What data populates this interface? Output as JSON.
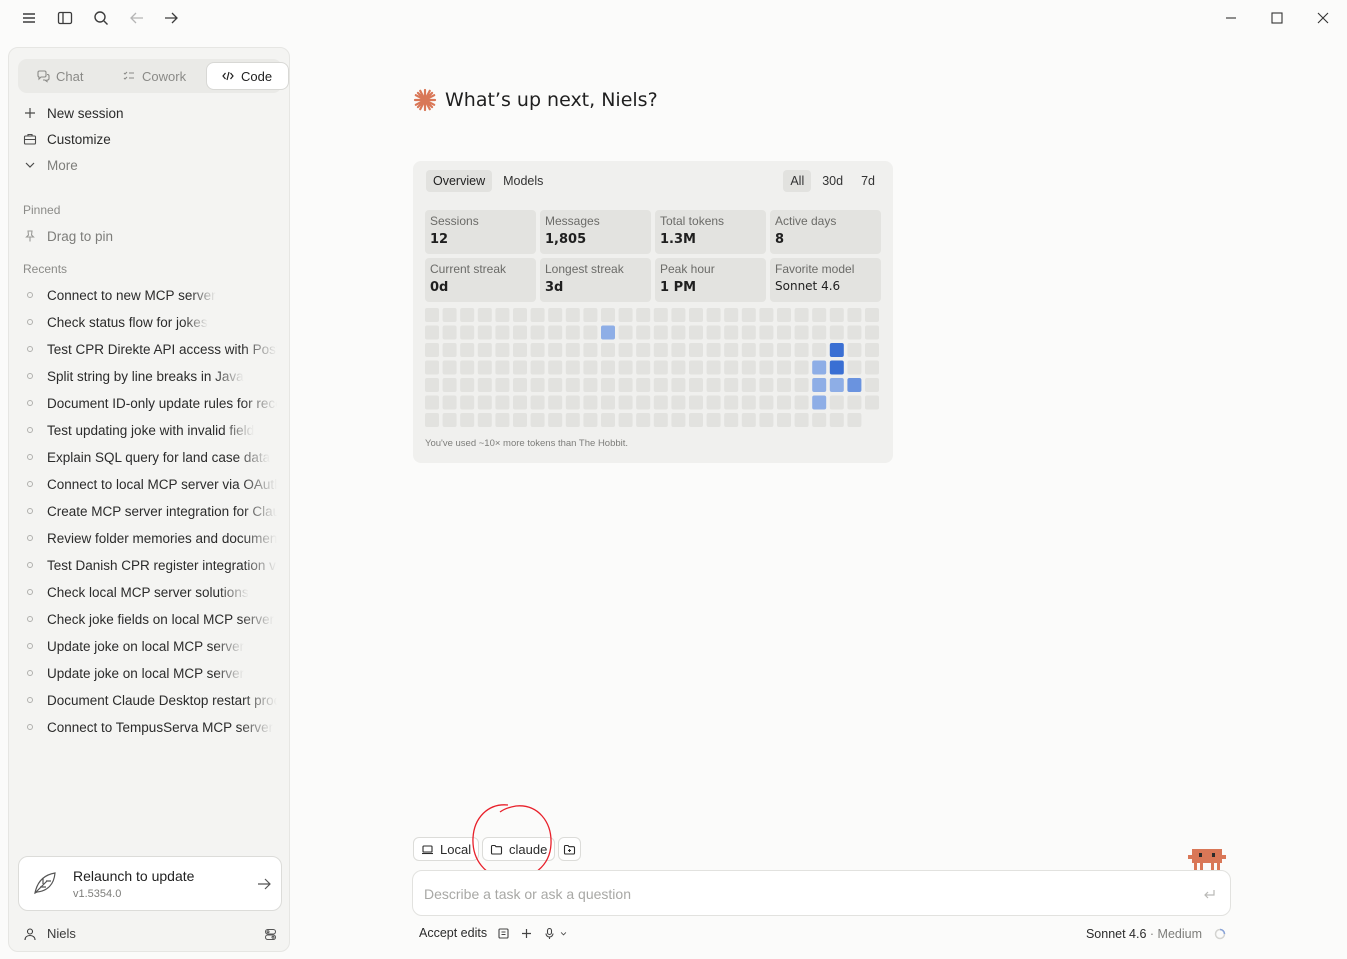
{
  "titlebar": {
    "icons": [
      "menu-icon",
      "sidebar-toggle-icon",
      "search-icon",
      "back-arrow-icon",
      "forward-arrow-icon"
    ],
    "window_controls": [
      "minimize-icon",
      "maximize-icon",
      "close-icon"
    ]
  },
  "sidebar": {
    "modes": [
      {
        "label": "Chat",
        "icon": "chat-icon",
        "active": false
      },
      {
        "label": "Cowork",
        "icon": "cowork-icon",
        "active": false
      },
      {
        "label": "Code",
        "icon": "code-icon",
        "active": true
      }
    ],
    "nav": [
      {
        "label": "New session",
        "icon": "plus-icon"
      },
      {
        "label": "Customize",
        "icon": "briefcase-icon"
      },
      {
        "label": "More",
        "icon": "chevron-down-icon"
      }
    ],
    "pinned_label": "Pinned",
    "drag_to_pin": "Drag to pin",
    "recents_label": "Recents",
    "recents": [
      "Connect to new MCP server",
      "Check status flow for jokes",
      "Test CPR Direkte API access with Postman",
      "Split string by line breaks in Java",
      "Document ID-only update rules for records",
      "Test updating joke with invalid field",
      "Explain SQL query for land case data",
      "Connect to local MCP server via OAuth",
      "Create MCP server integration for Claude",
      "Review folder memories and documents",
      "Test Danish CPR register integration via",
      "Check local MCP server solutions",
      "Check joke fields on local MCP server",
      "Update joke on local MCP server",
      "Update joke on local MCP server",
      "Document Claude Desktop restart process",
      "Connect to TempusServa MCP server"
    ],
    "update": {
      "title": "Relaunch to update",
      "version": "v1.5354.0"
    },
    "user": "Niels"
  },
  "main": {
    "greeting": "What’s up next, Niels?",
    "stats": {
      "tabs": [
        {
          "label": "Overview",
          "active": true
        },
        {
          "label": "Models",
          "active": false
        }
      ],
      "ranges": [
        {
          "label": "All",
          "active": true
        },
        {
          "label": "30d",
          "active": false
        },
        {
          "label": "7d",
          "active": false
        }
      ],
      "items": [
        {
          "label": "Sessions",
          "value": "12"
        },
        {
          "label": "Messages",
          "value": "1,805"
        },
        {
          "label": "Total tokens",
          "value": "1.3M"
        },
        {
          "label": "Active days",
          "value": "8"
        },
        {
          "label": "Current streak",
          "value": "0d"
        },
        {
          "label": "Longest streak",
          "value": "3d"
        },
        {
          "label": "Peak hour",
          "value": "1 PM"
        },
        {
          "label": "Favorite model",
          "value": "Sonnet 4.6"
        }
      ],
      "heatmap": {
        "weeks": 26,
        "days": 7,
        "active_days": [
          {
            "week": 10,
            "day": 1,
            "level": 1
          },
          {
            "week": 23,
            "day": 2,
            "level": 3
          },
          {
            "week": 23,
            "day": 3,
            "level": 3
          },
          {
            "week": 22,
            "day": 3,
            "level": 1
          },
          {
            "week": 22,
            "day": 4,
            "level": 1
          },
          {
            "week": 23,
            "day": 4,
            "level": 1
          },
          {
            "week": 24,
            "day": 4,
            "level": 2
          },
          {
            "week": 22,
            "day": 5,
            "level": 1
          }
        ],
        "colors": {
          "empty": "#e2e2df",
          "level1": "#8eaee6",
          "level2": "#6a93df",
          "level3": "#3a6fd3"
        }
      },
      "footnote": "You've used ~10× more tokens than The Hobbit."
    }
  },
  "composer": {
    "env_label": "Local",
    "folder_label": "claude",
    "placeholder": "Describe a task or ask a question",
    "accept_label": "Accept edits",
    "model": "Sonnet 4.6",
    "effort": "· Medium",
    "annotation_color": "#e8202a"
  }
}
